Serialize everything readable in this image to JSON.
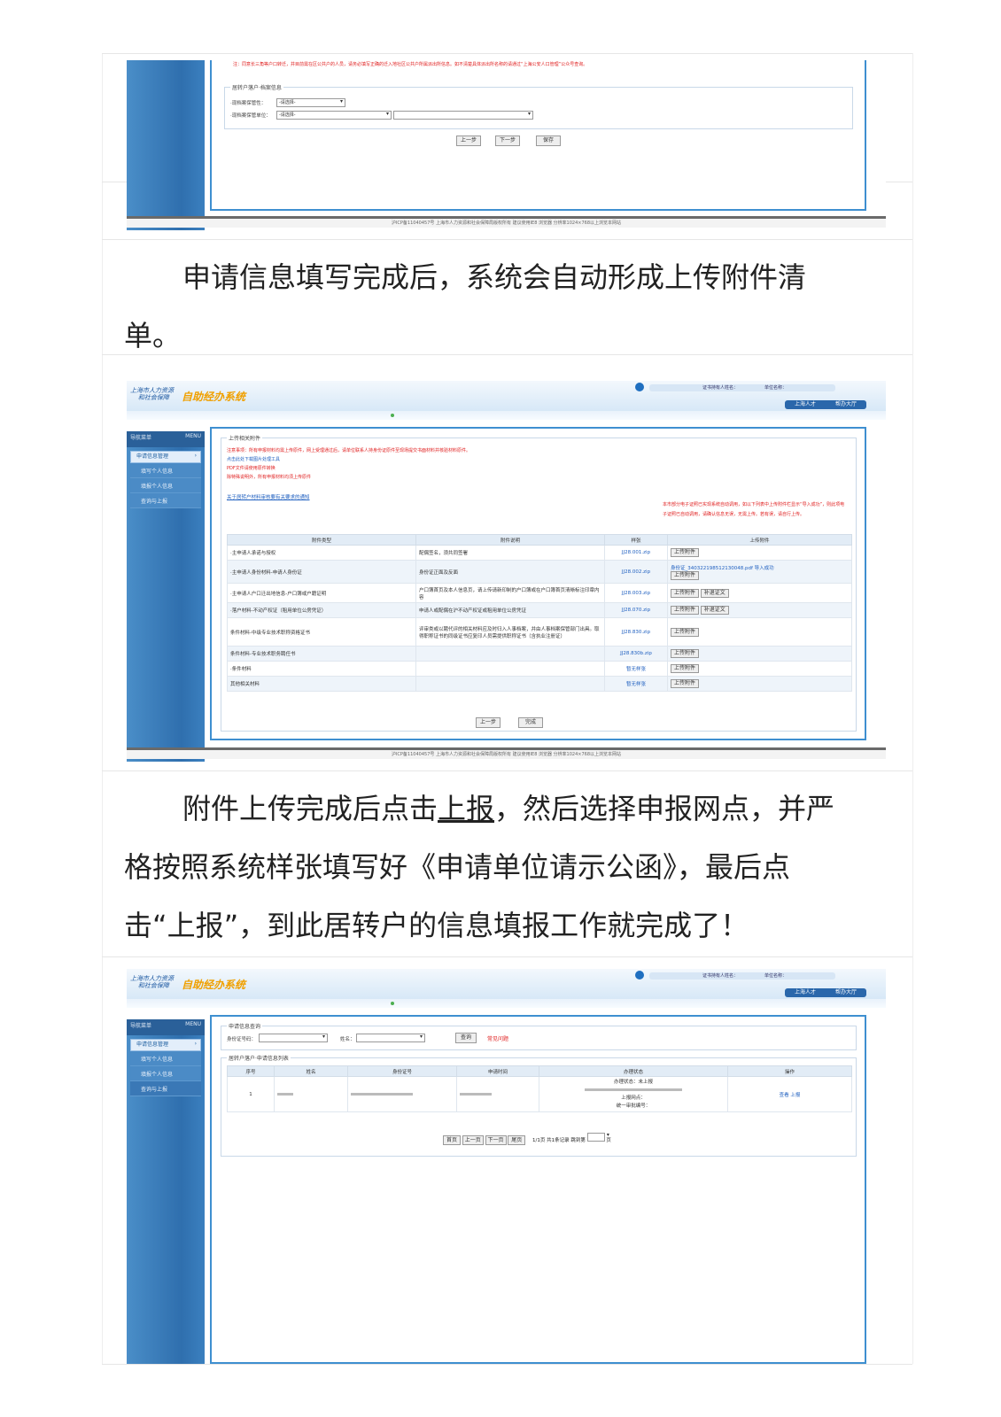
{
  "para1": {
    "line1": "申请信息填写完成后，系统会自动形成上传附件清",
    "line2": "单。"
  },
  "para2": {
    "line1_a": "附件上传完成后点击",
    "line1_link": "上报",
    "line1_b": "，然后选择申报网点，并严",
    "line2": "格按照系统样张填写好《申请单位请示公函》，最后点",
    "line3": "击“上报”，到此居转户的信息填报工作就完成了！"
  },
  "shot1": {
    "notice": "注：同意长三角等户口转迁，并目前需在区公共户的人员，请务必填写正确的迁入地社区公共户所属派出所信息。如不清楚具体派出所名称的请通过“上海公安人口管理”公众号查询。",
    "legend": "居转户落户·档案信息",
    "field1_label": "·现档案保管性：",
    "field1_value": "-请选择-",
    "field2_label": "·现档案保管单位：",
    "field2_value": "-请选择-",
    "buttons": [
      "上一步",
      "下一步",
      "保存"
    ],
    "footer": "沪ICP备11040457号  上海市人力资源和社会保障局版权所有  建议使用IE8 浏览器  分辨率1024×768以上浏览本网站"
  },
  "system": {
    "org": "上海市人力资源\n和社会保障",
    "name": "自助经办系统",
    "user_label": "证书持有人姓名：",
    "unit_label": "单位名称：",
    "nav": [
      "上海人才",
      "帮办大厅"
    ],
    "menu_title": "导航菜单",
    "menu_en": "MENU",
    "menu_active": "申请信息管理",
    "footer": "沪ICP备11040457号  上海市人力资源和社会保障局版权所有  建议使用IE8 浏览器  分辨率1024×768以上浏览本网站"
  },
  "shot2": {
    "menu_items": [
      "填写个人信息",
      "填报个人信息",
      "查询与上报"
    ],
    "legend": "上传相关附件",
    "notes": [
      "注意事项：所有申报材料均需上传原件，网上受理通过后，请单位联系人持身份证原件至现场提交书面材料并核验材料原件。",
      "点击此处下载图片处理工具",
      "PDF文件请使用原件转换",
      "除特殊说明外，所有申报材料均须上传原件"
    ],
    "link": "关于居转户材料审核要有关要求的通知",
    "right_note": "本市部分电子证照已实现系统自动调用，如以下列表中上传附件栏显示“导入成功”，则此项电子证照已自动调用，请确认信息无误，无需上传。若有误，请自行上传。",
    "headers": [
      "附件类型",
      "附件说明",
      "样张",
      "上传附件"
    ],
    "rows": [
      {
        "type": "·主申请人承诺与授权",
        "desc": "配偶签名，须共同签署",
        "sample": "JJ28.001.zip",
        "upload": "上传附件",
        "extra": ""
      },
      {
        "type": "·主申请人身份材料-申请人身份证",
        "desc": "身份证正面及反面",
        "sample": "JJ28.002.zip",
        "upload": "上传附件",
        "extra": "身份证_340322198512130048.pdf 导入成功"
      },
      {
        "type": "·主申请人户口迁出地信息-户口簿或户籍证明",
        "desc": "户口簿首页及本人信息页，请上传请新印制的户口簿或在户口簿首页清晰标注印章内容",
        "sample": "JJ28.003.zip",
        "upload": "上传附件",
        "extra": "补退证文"
      },
      {
        "type": "·落户材料-不动产权证（租用单位公房凭证）",
        "desc": "申请人或配偶在沪不动产权证或租用单位公房凭证",
        "sample": "JJ28.070.zip",
        "upload": "上传附件",
        "extra": "补退证文"
      },
      {
        "type": "条件材料-中级专业技术职称资格证书",
        "desc": "评审类或以聘代评的相关材料应及时归入人事档案，并由人事档案保管部门出具。取得职称证书的同级证书应复印人员需提供职称证书（含执业注册证）",
        "sample": "JJ28.830.zip",
        "upload": "上传附件",
        "extra": ""
      },
      {
        "type": "条件材料-专业技术职务聘任书",
        "desc": "",
        "sample": "JJ28.830b.zip",
        "upload": "上传附件",
        "extra": ""
      },
      {
        "type": "·条件材料",
        "desc": "",
        "sample": "暂无样张",
        "upload": "上传附件",
        "extra": ""
      },
      {
        "type": "其他相关材料",
        "desc": "",
        "sample": "暂无样张",
        "upload": "上传附件",
        "extra": ""
      }
    ],
    "buttons": [
      "上一步",
      "完成"
    ]
  },
  "shot3": {
    "menu_items": [
      "填写个人信息",
      "填报个人信息",
      "查询与上报"
    ],
    "query_legend": "申请信息查询",
    "id_label": "身份证号码：",
    "name_label": "姓名：",
    "query_btn": "查询",
    "faq": "常见问题",
    "list_legend": "居转户落户·申请信息列表",
    "headers": [
      "序号",
      "姓名",
      "身份证号",
      "申请时间",
      "办理状态",
      "操作"
    ],
    "row": {
      "index": "1",
      "status_1": "办理状态：未上报",
      "status_2": "上报网点：",
      "status_3": "统一审批编号：",
      "ops": "查看  上报"
    },
    "pager": [
      "首页",
      "上一页",
      "下一页",
      "尾页"
    ],
    "pager_info": "1/1页 共1条记录 跳到第",
    "pager_unit": "页"
  }
}
